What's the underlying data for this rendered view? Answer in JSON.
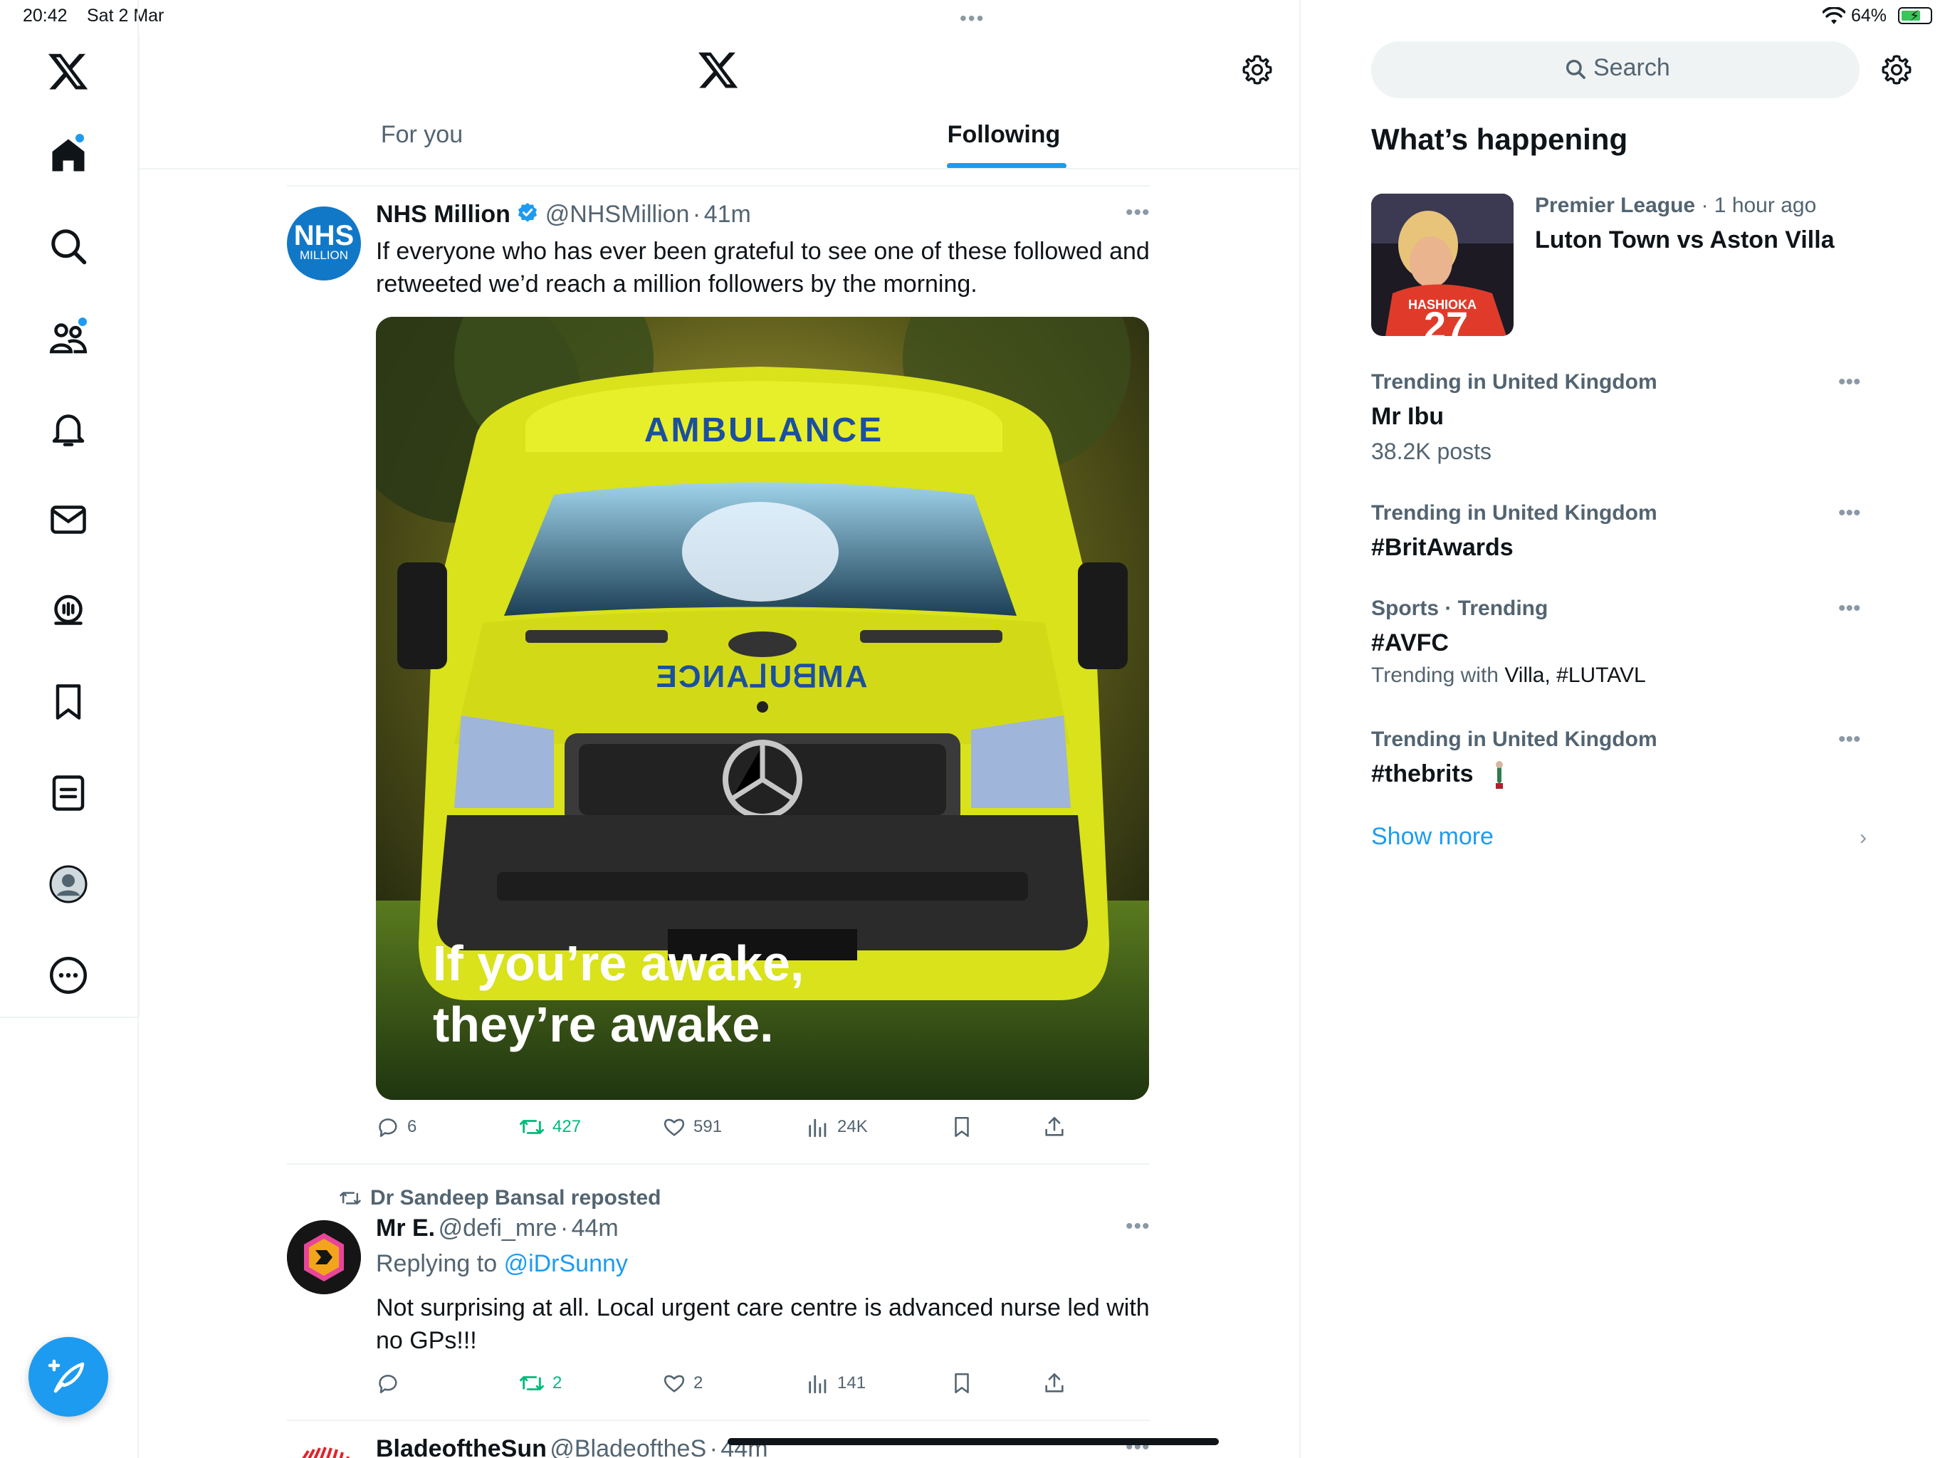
{
  "status_bar": {
    "time": "20:42",
    "date": "Sat 2 Mar",
    "battery": "64%",
    "battery_level": 0.64
  },
  "nav": {
    "items": [
      "x-logo",
      "home",
      "explore",
      "communities",
      "notifications",
      "messages",
      "spaces",
      "bookmarks",
      "lists",
      "profile",
      "more"
    ]
  },
  "tabs": [
    {
      "label": "For you",
      "active": false
    },
    {
      "label": "Following",
      "active": true
    }
  ],
  "tweets": [
    {
      "name": "NHS Million",
      "verified": true,
      "handle": "@NHSMillion",
      "time": "41m",
      "avatar": {
        "line1": "NHS",
        "line2": "MILLION"
      },
      "text": "If everyone who has ever been grateful to see one of these followed and retweeted we’d reach a million followers by the morning.",
      "media": {
        "caption_line1": "If you’re awake,",
        "caption_line2": "they’re awake.",
        "bonnet_text": "AMBULANCE",
        "mirror_text": "ƎƆИA⅃UᗺMA"
      },
      "actions": {
        "replies": "6",
        "reposts": "427",
        "likes": "591",
        "views": "24K"
      }
    },
    {
      "repost_by": "Dr Sandeep Bansal reposted",
      "name": "Mr E.",
      "handle": "@defi_mre",
      "time": "44m",
      "replying_prefix": "Replying to",
      "replying_to": "@iDrSunny",
      "text": "Not surprising at all. Local urgent care centre is advanced nurse led with no GPs!!!",
      "actions": {
        "replies": "",
        "reposts": "2",
        "likes": "2",
        "views": "141"
      }
    },
    {
      "name": "BladeoftheSun",
      "handle": "@BladeoftheS",
      "time": "44m"
    }
  ],
  "search": {
    "placeholder": "Search"
  },
  "whats_happening": {
    "title": "What’s happening",
    "featured": {
      "context": "Premier League",
      "time": "1 hour ago",
      "title": "Luton Town vs Aston Villa",
      "jersey_name": "HASHIOKA",
      "jersey_number": "27"
    },
    "trends": [
      {
        "context": "Trending in United Kingdom",
        "title": "Mr Ibu",
        "sub": "38.2K posts"
      },
      {
        "context": "Trending in United Kingdom",
        "title": "#BritAwards"
      },
      {
        "context": "Sports · Trending",
        "title": "#AVFC",
        "sub_prefix": "Trending with ",
        "sub_links": "Villa, #LUTAVL"
      },
      {
        "context": "Trending in United Kingdom",
        "title": "#thebrits"
      }
    ],
    "show_more": "Show more"
  },
  "colors": {
    "accent": "#1d9bf0",
    "repost_green": "#00ba7c",
    "muted": "#536471"
  }
}
